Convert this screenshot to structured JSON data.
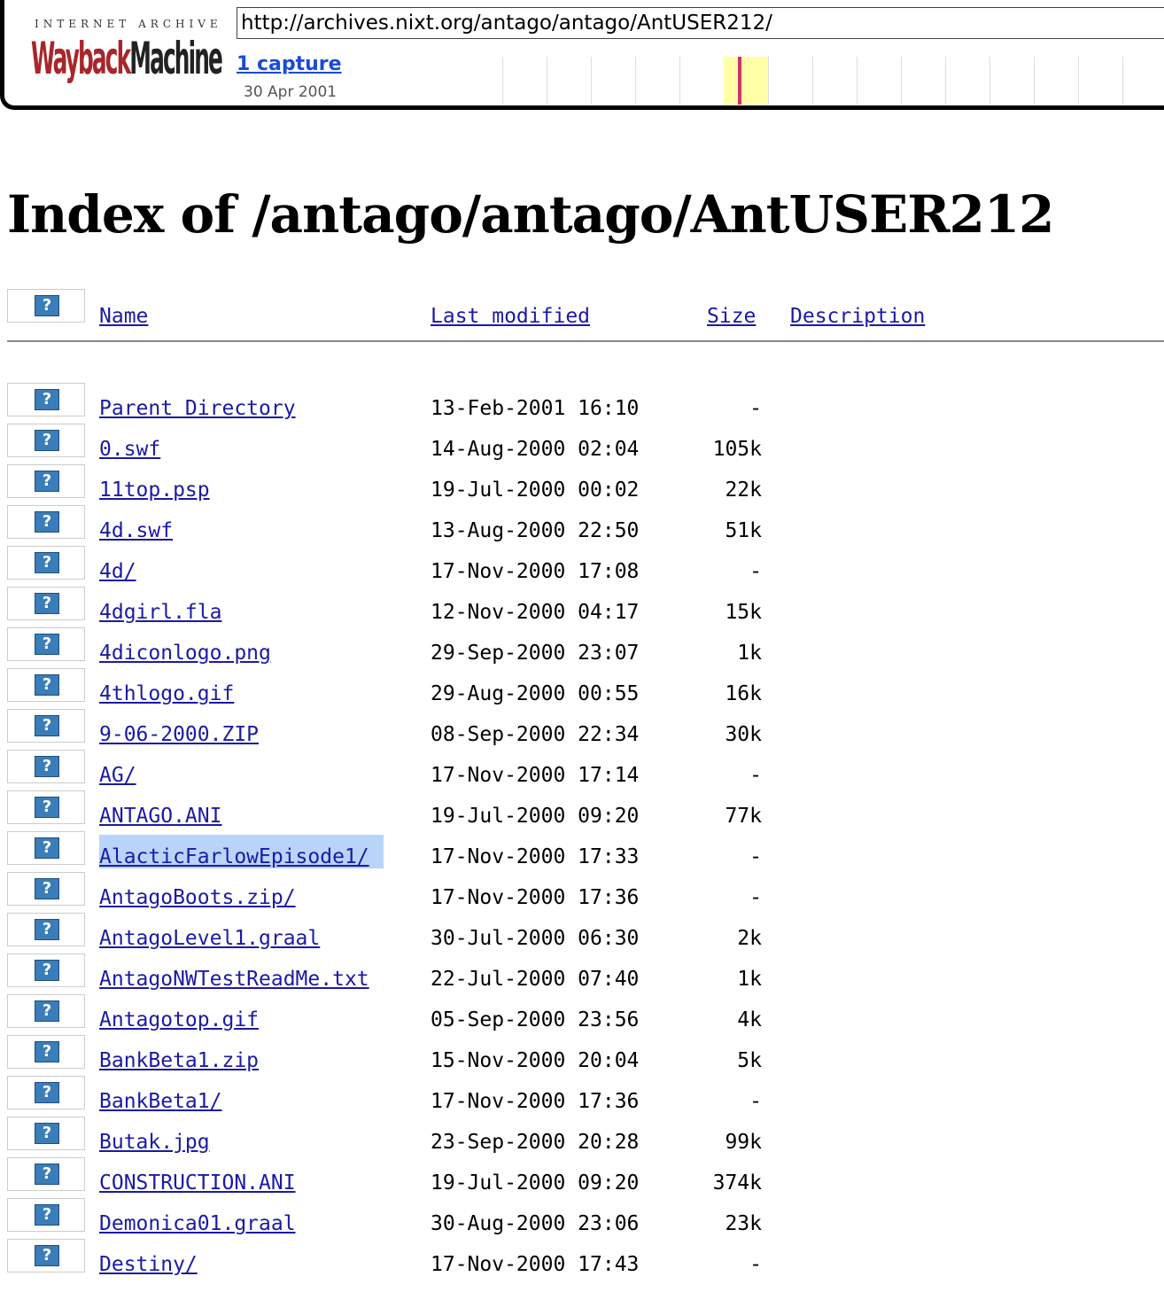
{
  "wayback": {
    "logo_top": "INTERNET ARCHIVE",
    "logo_wayback": "Wayback",
    "logo_machine": "Machine",
    "url": "http://archives.nixt.org/antago/antago/AntUSER212/",
    "captures_label": "1 capture",
    "capture_date": "30 Apr 2001",
    "colors": {
      "highlight": "#ffffa8",
      "marker": "#d0326c",
      "logo_red": "#a8262a"
    }
  },
  "page": {
    "title": "Index of /antago/antago/AntUSER212"
  },
  "table": {
    "headers": {
      "name": "Name",
      "last_modified": "Last modified",
      "size": "Size",
      "description": "Description"
    },
    "icon_glyph": "?",
    "rows": [
      {
        "name": "Parent Directory",
        "modified": "13-Feb-2001 16:10",
        "size": "-",
        "description": ""
      },
      {
        "name": "0.swf",
        "modified": "14-Aug-2000 02:04",
        "size": "105k",
        "description": ""
      },
      {
        "name": "11top.psp",
        "modified": "19-Jul-2000 00:02",
        "size": "22k",
        "description": ""
      },
      {
        "name": "4d.swf",
        "modified": "13-Aug-2000 22:50",
        "size": "51k",
        "description": ""
      },
      {
        "name": "4d/",
        "modified": "17-Nov-2000 17:08",
        "size": "-",
        "description": ""
      },
      {
        "name": "4dgirl.fla",
        "modified": "12-Nov-2000 04:17",
        "size": "15k",
        "description": ""
      },
      {
        "name": "4diconlogo.png",
        "modified": "29-Sep-2000 23:07",
        "size": "1k",
        "description": ""
      },
      {
        "name": "4thlogo.gif",
        "modified": "29-Aug-2000 00:55",
        "size": "16k",
        "description": ""
      },
      {
        "name": "9-06-2000.ZIP",
        "modified": "08-Sep-2000 22:34",
        "size": "30k",
        "description": ""
      },
      {
        "name": "AG/",
        "modified": "17-Nov-2000 17:14",
        "size": "-",
        "description": ""
      },
      {
        "name": "ANTAGO.ANI",
        "modified": "19-Jul-2000 09:20",
        "size": "77k",
        "description": ""
      },
      {
        "name": "AlacticFarlowEpisode1/",
        "modified": "17-Nov-2000 17:33",
        "size": "-",
        "description": "",
        "selected": true
      },
      {
        "name": "AntagoBoots.zip/",
        "modified": "17-Nov-2000 17:36",
        "size": "-",
        "description": ""
      },
      {
        "name": "AntagoLevel1.graal",
        "modified": "30-Jul-2000 06:30",
        "size": "2k",
        "description": ""
      },
      {
        "name": "AntagoNWTestReadMe.txt",
        "modified": "22-Jul-2000 07:40",
        "size": "1k",
        "description": ""
      },
      {
        "name": "Antagotop.gif",
        "modified": "05-Sep-2000 23:56",
        "size": "4k",
        "description": ""
      },
      {
        "name": "BankBeta1.zip",
        "modified": "15-Nov-2000 20:04",
        "size": "5k",
        "description": ""
      },
      {
        "name": "BankBeta1/",
        "modified": "17-Nov-2000 17:36",
        "size": "-",
        "description": ""
      },
      {
        "name": "Butak.jpg",
        "modified": "23-Sep-2000 20:28",
        "size": "99k",
        "description": ""
      },
      {
        "name": "CONSTRUCTION.ANI",
        "modified": "19-Jul-2000 09:20",
        "size": "374k",
        "description": ""
      },
      {
        "name": "Demonica01.graal",
        "modified": "30-Aug-2000 23:06",
        "size": "23k",
        "description": ""
      },
      {
        "name": "Destiny/",
        "modified": "17-Nov-2000 17:43",
        "size": "-",
        "description": ""
      }
    ]
  }
}
